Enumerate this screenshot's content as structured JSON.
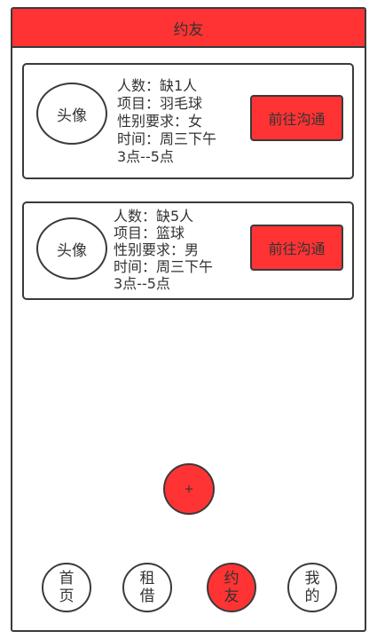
{
  "header": {
    "title": "约友"
  },
  "cards": [
    {
      "avatar_label": "头像",
      "lines": [
        "人数：缺1人",
        "项目：羽毛球",
        "性别要求：女",
        "时间：周三下午",
        "3点--5点"
      ],
      "button_label": "前往沟通"
    },
    {
      "avatar_label": "头像",
      "lines": [
        "人数：缺5人",
        "项目：篮球",
        "性别要求：男",
        "时间：周三下午",
        "3点--5点"
      ],
      "button_label": "前往沟通"
    }
  ],
  "fab": {
    "label": "+"
  },
  "bottom_nav": {
    "items": [
      {
        "label": "首页"
      },
      {
        "label": "租借"
      },
      {
        "label": "约友",
        "active": true
      },
      {
        "label": "我的"
      }
    ]
  },
  "colors": {
    "accent": "#ff3333",
    "border": "#3a3a3a",
    "text": "#333333",
    "background": "#ffffff"
  }
}
